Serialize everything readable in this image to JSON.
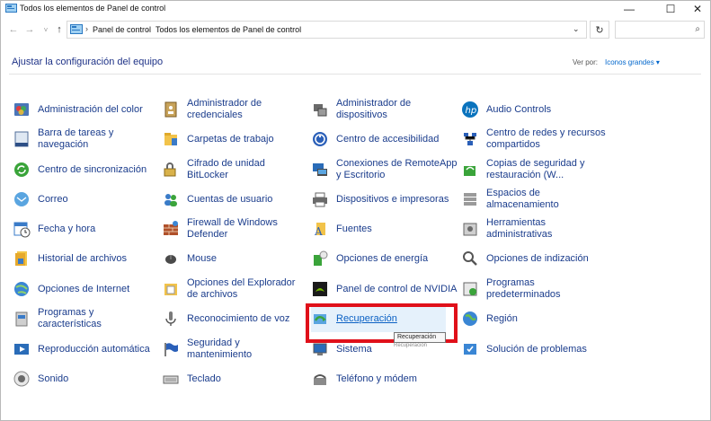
{
  "window": {
    "title": "Todos los elementos de Panel de control",
    "minimize": "—",
    "maximize": "☐",
    "close": "✕"
  },
  "nav": {
    "back": "←",
    "forward": "→",
    "recent": "˅",
    "up": "↑",
    "breadcrumbs": [
      "Panel de control",
      "Todos los elementos de Panel de control"
    ],
    "separator": "›",
    "dropdown": "⌄",
    "refresh": "↻",
    "search_placeholder": "",
    "search_icon": "⌕"
  },
  "header": {
    "title": "Ajustar la configuración del equipo",
    "view_by_label": "Ver por:",
    "view_by_value": "Iconos grandes ▾"
  },
  "items": {
    "c1": [
      {
        "label": "Administración del color",
        "icon": "color-management-icon"
      },
      {
        "label": "Barra de tareas y\nnavegación",
        "icon": "taskbar-icon"
      },
      {
        "label": "Centro de sincronización",
        "icon": "sync-center-icon"
      },
      {
        "label": "Correo",
        "icon": "mail-icon"
      },
      {
        "label": "Fecha y hora",
        "icon": "date-time-icon"
      },
      {
        "label": "Historial de archivos",
        "icon": "file-history-icon"
      },
      {
        "label": "Opciones de Internet",
        "icon": "internet-options-icon"
      },
      {
        "label": "Programas y\ncaracterísticas",
        "icon": "programs-icon"
      },
      {
        "label": "Reproducción automática",
        "icon": "autoplay-icon"
      },
      {
        "label": "Sonido",
        "icon": "sound-icon"
      }
    ],
    "c2": [
      {
        "label": "Administrador de\ncredenciales",
        "icon": "credential-manager-icon"
      },
      {
        "label": "Carpetas de trabajo",
        "icon": "work-folders-icon"
      },
      {
        "label": "Cifrado de unidad\nBitLocker",
        "icon": "bitlocker-icon"
      },
      {
        "label": "Cuentas de usuario",
        "icon": "user-accounts-icon"
      },
      {
        "label": "Firewall de Windows\nDefender",
        "icon": "firewall-icon"
      },
      {
        "label": "Mouse",
        "icon": "mouse-icon"
      },
      {
        "label": "Opciones del Explorador\nde archivos",
        "icon": "explorer-options-icon"
      },
      {
        "label": "Reconocimiento de voz",
        "icon": "microphone-icon"
      },
      {
        "label": "Seguridad y\nmantenimiento",
        "icon": "security-flag-icon"
      },
      {
        "label": "Teclado",
        "icon": "keyboard-icon"
      }
    ],
    "c3": [
      {
        "label": "Administrador de\ndispositivos",
        "icon": "device-manager-icon"
      },
      {
        "label": "Centro de accesibilidad",
        "icon": "accessibility-icon"
      },
      {
        "label": "Conexiones de RemoteApp\ny Escritorio",
        "icon": "remoteapp-icon"
      },
      {
        "label": "Dispositivos e impresoras",
        "icon": "printer-icon"
      },
      {
        "label": "Fuentes",
        "icon": "fonts-icon"
      },
      {
        "label": "Opciones de energía",
        "icon": "power-icon"
      },
      {
        "label": "Panel de control de NVIDIA",
        "icon": "nvidia-icon"
      },
      {
        "label": "Recuperación",
        "icon": "recovery-icon"
      },
      {
        "label": "Sistema",
        "icon": "system-icon"
      },
      {
        "label": "Teléfono y módem",
        "icon": "phone-modem-icon"
      }
    ],
    "c4": [
      {
        "label": "Audio Controls",
        "icon": "hp-logo-icon"
      },
      {
        "label": "Centro de redes y recursos\ncompartidos",
        "icon": "network-icon"
      },
      {
        "label": "Copias de seguridad y\nrestauración (W...",
        "icon": "backup-icon"
      },
      {
        "label": "Espacios de\nalmacenamiento",
        "icon": "storage-spaces-icon"
      },
      {
        "label": "Herramientas\nadministrativas",
        "icon": "admin-tools-icon"
      },
      {
        "label": "Opciones de indización",
        "icon": "indexing-icon"
      },
      {
        "label": "Programas\npredeterminados",
        "icon": "default-programs-icon"
      },
      {
        "label": "Región",
        "icon": "region-icon"
      },
      {
        "label": "Solución de problemas",
        "icon": "troubleshooting-icon"
      }
    ]
  },
  "tooltip": {
    "text": "Recuperación",
    "shadow_text": "Recuperación"
  },
  "colors": {
    "link": "#1a3c8c",
    "title": "#1e3287",
    "highlight": "#e0101a",
    "hover": "#e5f1fb"
  }
}
